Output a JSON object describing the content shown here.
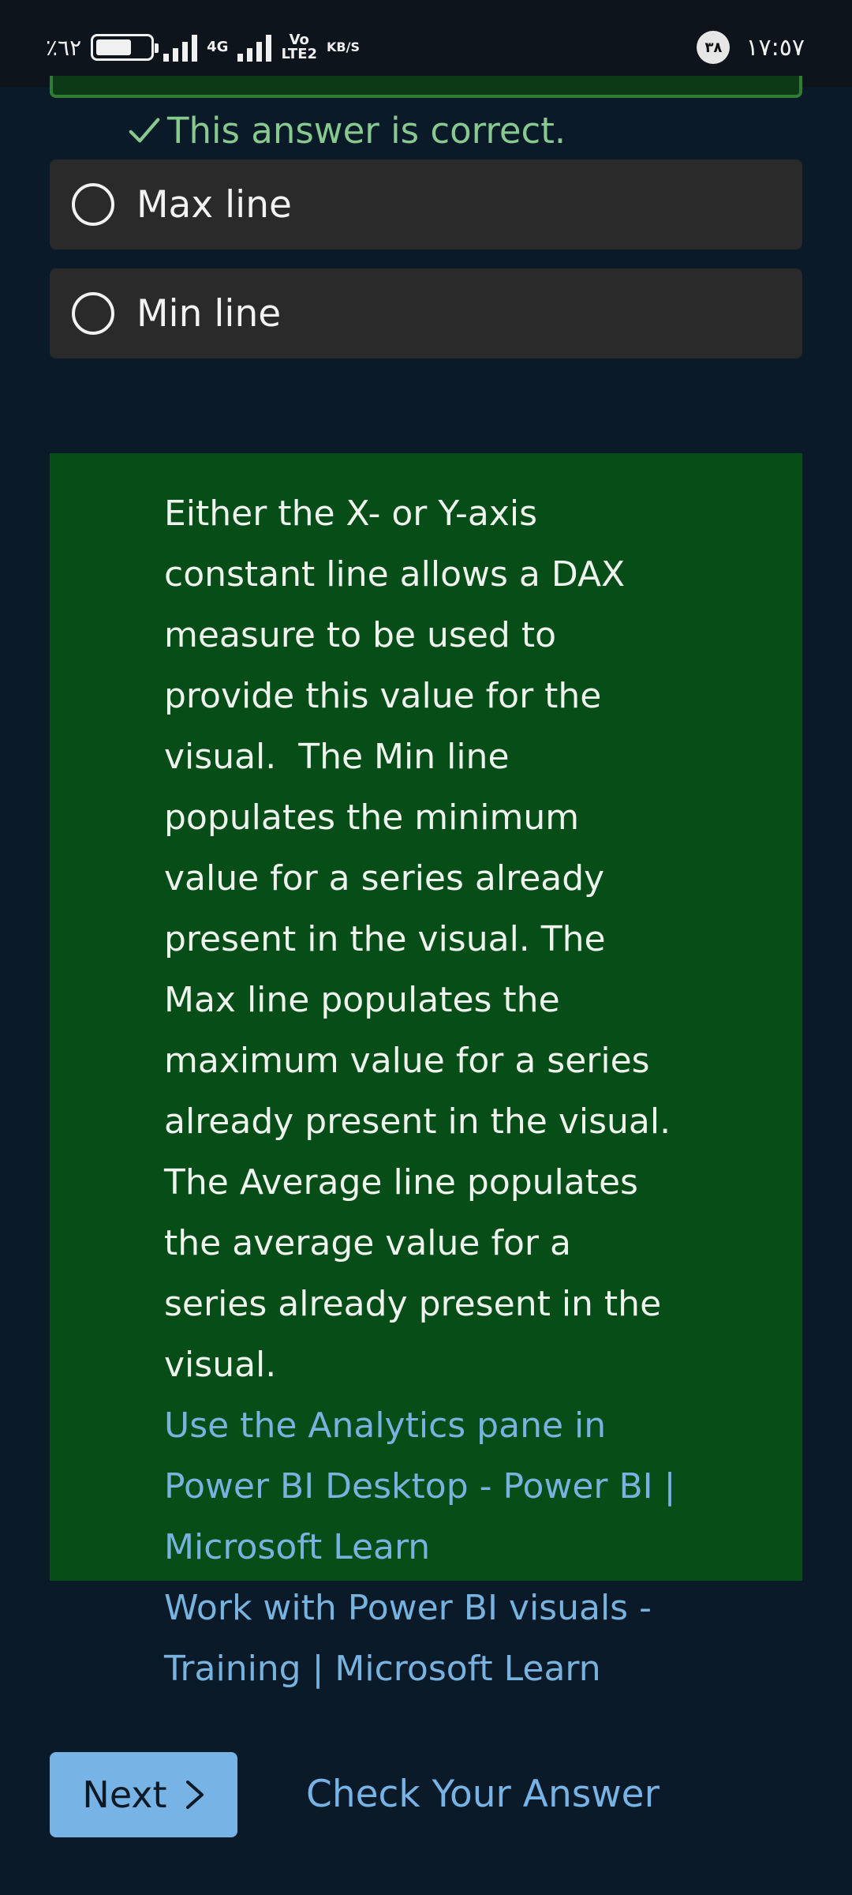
{
  "status_bar": {
    "battery_text": "٪٦٢",
    "net_4g": "4G",
    "volte_top": "Vo",
    "volte_bottom": "LTE2",
    "speed_unit": "KB/S",
    "notification_count": "٣٨",
    "time": "١٧:٥٧"
  },
  "quiz": {
    "correct_message": "This answer is correct.",
    "options": [
      {
        "label": "Max line"
      },
      {
        "label": "Min line"
      }
    ]
  },
  "explanation": {
    "text": "Either the X- or Y-axis constant line allows a DAX measure to be used to provide this value for the visual.  The Min line populates the minimum value for a series already present in the visual. The Max line populates the maximum value for a series already present in the visual. The Average line populates the average value for a series already present in the visual.",
    "links": [
      {
        "label": "Use the Analytics pane in Power BI Desktop - Power BI | Microsoft Learn"
      },
      {
        "label": "Work with Power BI visuals - Training | Microsoft Learn"
      }
    ]
  },
  "actions": {
    "next_label": "Next",
    "check_label": "Check Your Answer"
  },
  "colors": {
    "background": "#0b1a28",
    "correct_green": "#87c98f",
    "explanation_bg": "#064d18",
    "link_blue": "#78b3e0",
    "button_blue": "#78b3e6"
  }
}
